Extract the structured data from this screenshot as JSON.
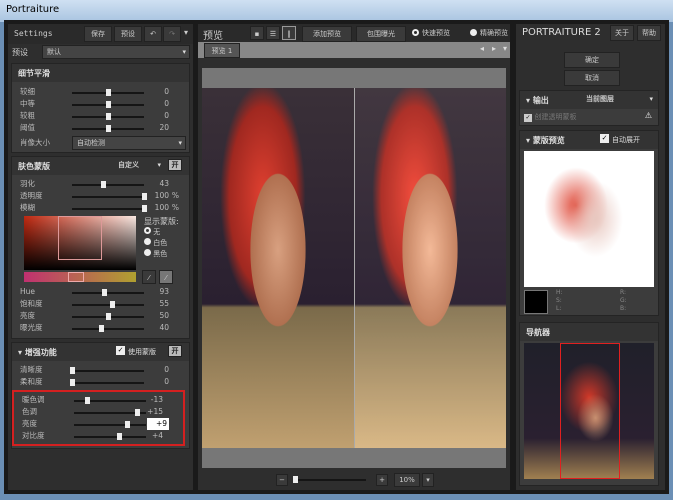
{
  "window": {
    "title": "Portraiture"
  },
  "left": {
    "settings_label": "Settings",
    "save": "保存",
    "preset": "预设",
    "preset_label": "预设",
    "preset_value": "默认",
    "detail": {
      "title": "细节平滑",
      "sliders": [
        {
          "label": "较细",
          "value": "0",
          "pos": 0.5
        },
        {
          "label": "中等",
          "value": "0",
          "pos": 0.5
        },
        {
          "label": "较粗",
          "value": "0",
          "pos": 0.5
        },
        {
          "label": "阈值",
          "value": "20",
          "pos": 0.5
        }
      ],
      "size_label": "肖像大小",
      "size_value": "自动检测"
    },
    "skin": {
      "title": "肤色蒙版",
      "mode": "自定义",
      "toggle": "开",
      "sliders": [
        {
          "label": "羽化",
          "value": "43",
          "unit": "",
          "pos": 0.43
        },
        {
          "label": "透明度",
          "value": "100",
          "unit": "%",
          "pos": 1
        },
        {
          "label": "模糊",
          "value": "100",
          "unit": "%",
          "pos": 1
        }
      ],
      "show_mask": "显示蒙版:",
      "radios": [
        {
          "label": "无",
          "checked": true
        },
        {
          "label": "白色",
          "checked": false
        },
        {
          "label": "黑色",
          "checked": false
        }
      ],
      "hsl": [
        {
          "label": "Hue",
          "value": "93",
          "pos": 0.45
        },
        {
          "label": "饱和度",
          "value": "55",
          "pos": 0.55
        },
        {
          "label": "亮度",
          "value": "50",
          "pos": 0.5
        },
        {
          "label": "曝光度",
          "value": "40",
          "pos": 0.4
        }
      ]
    },
    "enh": {
      "title": "增强功能",
      "use_mask": "使用蒙版",
      "toggle": "开",
      "sliders": [
        {
          "label": "清晰度",
          "value": "0",
          "pos": 0
        },
        {
          "label": "柔和度",
          "value": "0",
          "pos": 0
        }
      ],
      "highlighted": [
        {
          "label": "暖色调",
          "value": "-13",
          "pos": 0.18
        },
        {
          "label": "色调",
          "value": "+15",
          "pos": 0.88
        },
        {
          "label": "亮度",
          "value": "+9",
          "pos": 0.73,
          "editing": true
        },
        {
          "label": "对比度",
          "value": "+4",
          "pos": 0.62
        }
      ]
    }
  },
  "center": {
    "title": "预览",
    "add_preview": "添加预览",
    "clip": "包围曝光",
    "fast": "快速预览",
    "accurate": "精确预览",
    "tab": "预览 1",
    "zoom": "10%",
    "zoom_pos": 0.02
  },
  "right": {
    "logo": "PORTRAITURE 2",
    "about": "关于",
    "help": "帮助",
    "ok": "确定",
    "cancel": "取消",
    "output": {
      "title": "输出",
      "value": "当前图层",
      "create_mask": "创建透明蒙板"
    },
    "mask": {
      "title": "蒙版预览",
      "auto": "自动展开",
      "hsl": [
        "H:",
        "S:",
        "L:"
      ],
      "rgb": [
        "R:",
        "G:",
        "B:"
      ]
    },
    "navigator": "导航器"
  },
  "colors": {
    "highlight": "#d42020",
    "panel": "#2e2e2e"
  }
}
